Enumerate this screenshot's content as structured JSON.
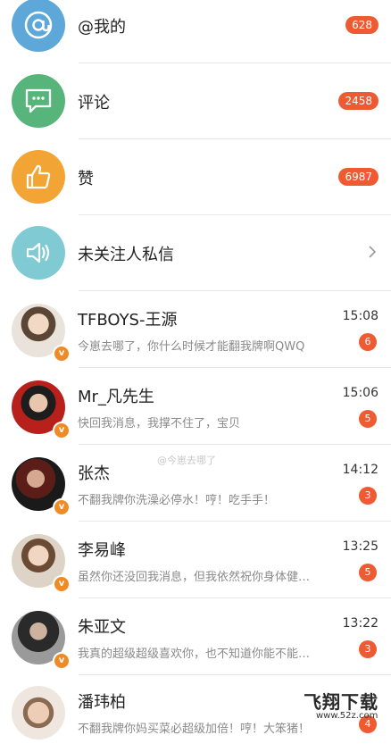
{
  "notifications": [
    {
      "label": "@我的",
      "count": "628",
      "icon": "at-icon",
      "color": "#5da8d8"
    },
    {
      "label": "评论",
      "count": "2458",
      "icon": "comment-icon",
      "color": "#57b47a"
    },
    {
      "label": "赞",
      "count": "6987",
      "icon": "thumbs-up-icon",
      "color": "#f2a534"
    },
    {
      "label": "未关注人私信",
      "icon": "speaker-icon",
      "color": "#7fcad3"
    }
  ],
  "conversations": [
    {
      "name": "TFBOYS-王源",
      "time": "15:08",
      "message": "今崽去哪了，你什么时候才能翻我牌啊QWQ",
      "unread": "6",
      "verified": "v"
    },
    {
      "name": "Mr_凡先生",
      "time": "15:06",
      "message": "快回我消息，我撑不住了，宝贝",
      "unread": "5",
      "verified": "v"
    },
    {
      "name": "张杰",
      "time": "14:12",
      "message": "不翻我牌你洗澡必停水！哼！吃手手！",
      "unread": "3",
      "verified": "v"
    },
    {
      "name": "李易峰",
      "time": "13:25",
      "message": "虽然你还没回我消息，但我依然祝你身体健…",
      "unread": "5",
      "verified": "v"
    },
    {
      "name": "朱亚文",
      "time": "13:22",
      "message": "我真的超级超级喜欢你，也不知道你能不能…",
      "unread": "3",
      "verified": "v"
    },
    {
      "name": "潘玮柏",
      "time": "",
      "message": "不翻我牌你妈买菜必超级加倍！哼！大笨猪！",
      "unread": "4",
      "verified": "v"
    }
  ],
  "watermark": "@今崽去哪了",
  "site_logo": {
    "main": "飞翔下载",
    "sub": "www.52z.com"
  },
  "accent_color": "#ee5b33"
}
